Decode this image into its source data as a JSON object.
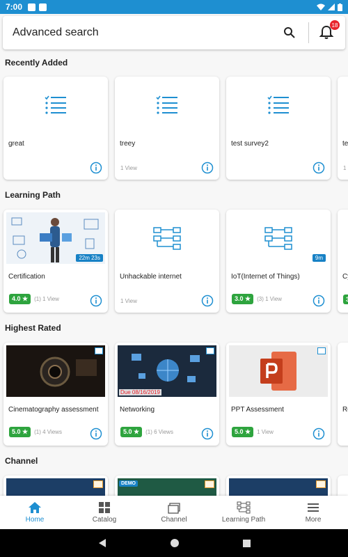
{
  "status_bar": {
    "time": "7:00"
  },
  "search": {
    "placeholder": "Advanced search",
    "notification_count": "18"
  },
  "sections": {
    "recently_added": {
      "title": "Recently Added",
      "items": [
        {
          "title": "great",
          "meta": ""
        },
        {
          "title": "treey",
          "meta": "1 View"
        },
        {
          "title": "test survey2",
          "meta": ""
        },
        {
          "title": "te",
          "meta": "1"
        }
      ]
    },
    "learning_path": {
      "title": "Learning Path",
      "items": [
        {
          "title": "Certification",
          "rating": "4.0 ★",
          "meta": "(1) 1 View",
          "duration": "22m 23s"
        },
        {
          "title": "Unhackable internet",
          "meta": "1 View"
        },
        {
          "title": "IoT(Internet of Things)",
          "rating": "3.0 ★",
          "meta": "(3) 1 View",
          "duration": "9m"
        },
        {
          "title": "Cy",
          "rating": "3"
        }
      ]
    },
    "highest_rated": {
      "title": "Highest Rated",
      "items": [
        {
          "title": "Cinematography assessment",
          "rating": "5.0 ★",
          "meta": "(1) 4 Views"
        },
        {
          "title": "Networking",
          "rating": "5.0 ★",
          "meta": "(1) 6 Views",
          "due": "Due 08/16/2019"
        },
        {
          "title": "PPT Assessment",
          "rating": "5.0 ★",
          "meta": "1 View"
        },
        {
          "title": "Ro"
        }
      ]
    },
    "channel": {
      "title": "Channel",
      "demo_label": "DEMO"
    }
  },
  "bottom_nav": {
    "home": "Home",
    "catalog": "Catalog",
    "channel": "Channel",
    "learning_path": "Learning Path",
    "more": "More"
  },
  "colors": {
    "accent": "#1e8fd1",
    "rating_green": "#2ea43e",
    "badge_red": "#e8232b"
  }
}
